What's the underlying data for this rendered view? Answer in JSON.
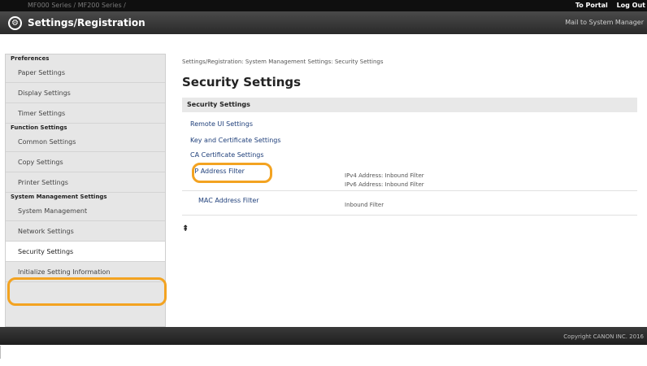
{
  "topbar": {
    "device": "MF000 Series / MF200 Series /",
    "portal_link": "To Portal",
    "logout_link": "Log Out"
  },
  "header": {
    "icon": "settings-gear-icon",
    "title": "Settings/Registration",
    "mail_link": "Mail to System Manager"
  },
  "sidebar": {
    "sections": [
      {
        "title": "Preferences",
        "items": [
          "Paper Settings",
          "Display Settings",
          "Timer Settings"
        ]
      },
      {
        "title": "Function Settings",
        "items": [
          "Common Settings",
          "Copy Settings",
          "Printer Settings"
        ]
      },
      {
        "title": "System Management Settings",
        "items": [
          "System Management",
          "Network Settings",
          "Security Settings",
          "Initialize Setting Information"
        ]
      }
    ],
    "active_item": "Security Settings"
  },
  "main": {
    "breadcrumb": "Settings/Registration: System Management Settings: Security Settings",
    "page_title": "Security Settings",
    "section_title": "Security Settings",
    "links": [
      {
        "label": "Remote UI Settings"
      },
      {
        "label": "Key and Certificate Settings"
      },
      {
        "label": "CA Certificate Settings"
      },
      {
        "label": "IP Address Filter",
        "desc": [
          "IPv4 Address: Inbound Filter",
          "IPv6 Address: Inbound Filter"
        ]
      },
      {
        "label": "MAC Address Filter",
        "desc": [
          "Inbound Filter"
        ]
      }
    ],
    "to_top_icon": "to-top-arrow-icon"
  },
  "footer": {
    "copyright": "Copyright CANON INC. 2016"
  },
  "colors": {
    "highlight": "#f3a321",
    "link": "#1f3f7a"
  }
}
